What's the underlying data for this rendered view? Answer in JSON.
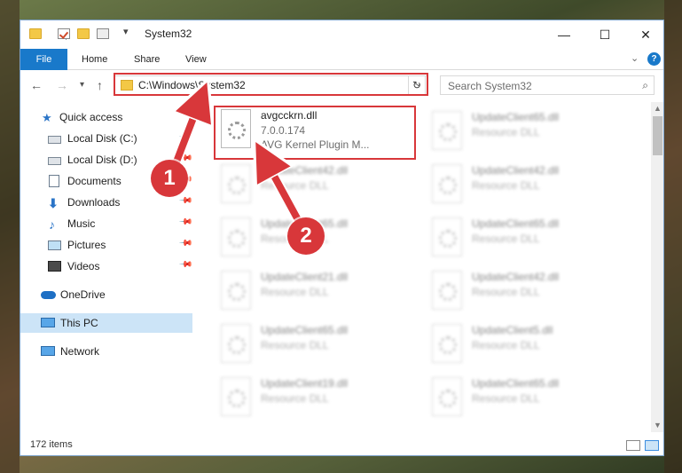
{
  "window": {
    "title": "System32"
  },
  "ribbon": {
    "tabs": [
      "File",
      "Home",
      "Share",
      "View"
    ]
  },
  "navigation": {
    "address": "C:\\Windows\\System32",
    "search_placeholder": "Search System32"
  },
  "sidebar": {
    "items": [
      {
        "label": "Quick access",
        "icon": "star-icon",
        "pinned": false
      },
      {
        "label": "Local Disk (C:)",
        "icon": "drive-icon",
        "pinned": true
      },
      {
        "label": "Local Disk (D:)",
        "icon": "drive-icon",
        "pinned": true
      },
      {
        "label": "Documents",
        "icon": "documents-icon",
        "pinned": true
      },
      {
        "label": "Downloads",
        "icon": "download-icon",
        "pinned": true
      },
      {
        "label": "Music",
        "icon": "music-icon",
        "pinned": true
      },
      {
        "label": "Pictures",
        "icon": "pictures-icon",
        "pinned": true
      },
      {
        "label": "Videos",
        "icon": "videos-icon",
        "pinned": true
      },
      {
        "label": "OneDrive",
        "icon": "cloud-icon",
        "pinned": false
      },
      {
        "label": "This PC",
        "icon": "computer-icon",
        "pinned": false,
        "selected": true
      },
      {
        "label": "Network",
        "icon": "network-icon",
        "pinned": false
      }
    ]
  },
  "files": {
    "highlighted": {
      "name": "avgcckrn.dll",
      "version": "7.0.0.174",
      "description": "AVG Kernel Plugin M..."
    },
    "items": [
      {
        "name": "UpdateClient65.dll",
        "type": "Resource DLL"
      },
      {
        "name": "UpdateClient42.dll",
        "type": "Resource DLL"
      },
      {
        "name": "UpdateClient42.dll",
        "type": "Resource DLL"
      },
      {
        "name": "UpdateClient65.dll",
        "type": "Resource DLL"
      },
      {
        "name": "UpdateClient65.dll",
        "type": "Resource DLL"
      },
      {
        "name": "UpdateClient21.dll",
        "type": "Resource DLL"
      },
      {
        "name": "UpdateClient42.dll",
        "type": "Resource DLL"
      },
      {
        "name": "UpdateClient65.dll",
        "type": "Resource DLL"
      },
      {
        "name": "UpdateClient5.dll",
        "type": "Resource DLL"
      },
      {
        "name": "UpdateClient19.dll",
        "type": "Resource DLL"
      },
      {
        "name": "UpdateClient65.dll",
        "type": "Resource DLL"
      }
    ]
  },
  "status": {
    "item_count": "172 items"
  },
  "annotations": {
    "step1": "1",
    "step2": "2"
  },
  "colors": {
    "accent": "#1979ca",
    "highlight": "#d8373a",
    "selection": "#cce4f7"
  }
}
